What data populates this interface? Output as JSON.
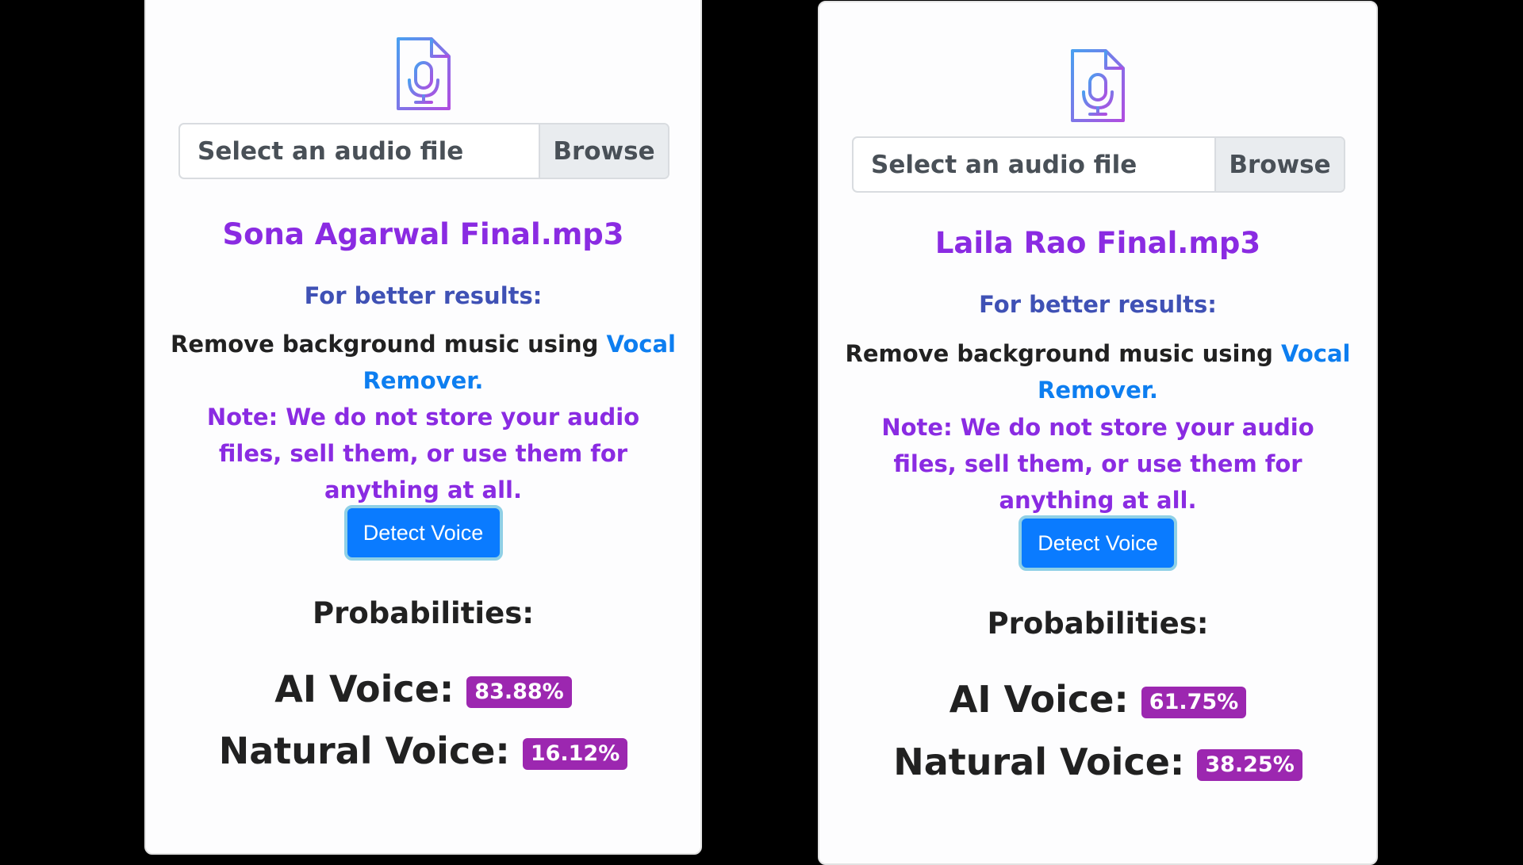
{
  "colors": {
    "filename": "#8a2be2",
    "better_results": "#3f51b5",
    "link": "#0d7ef0",
    "note": "#8a2be2",
    "button": "#0a7bff",
    "badge": "#9c27b0"
  },
  "panels": [
    {
      "icon": "audio-file-microphone-icon",
      "file_input_placeholder": "Select an audio file",
      "browse_label": "Browse",
      "filename": "Sona Agarwal Final.mp3",
      "better_results": "For better results:",
      "remove_text": "Remove background music using ",
      "remove_link": "Vocal Remover.",
      "note": "Note: We do not store your audio files, sell them, or use them for anything at all.",
      "detect_label": "Detect Voice",
      "probabilities_title": "Probabilities:",
      "ai_label": "AI Voice:",
      "ai_value": "83.88%",
      "natural_label": "Natural Voice:",
      "natural_value": "16.12%"
    },
    {
      "icon": "audio-file-microphone-icon",
      "file_input_placeholder": "Select an audio file",
      "browse_label": "Browse",
      "filename": "Laila Rao Final.mp3",
      "better_results": "For better results:",
      "remove_text": "Remove background music using ",
      "remove_link": "Vocal Remover.",
      "note": "Note: We do not store your audio files, sell them, or use them for anything at all.",
      "detect_label": "Detect Voice",
      "probabilities_title": "Probabilities:",
      "ai_label": "AI Voice:",
      "ai_value": "61.75%",
      "natural_label": "Natural Voice:",
      "natural_value": "38.25%"
    }
  ]
}
